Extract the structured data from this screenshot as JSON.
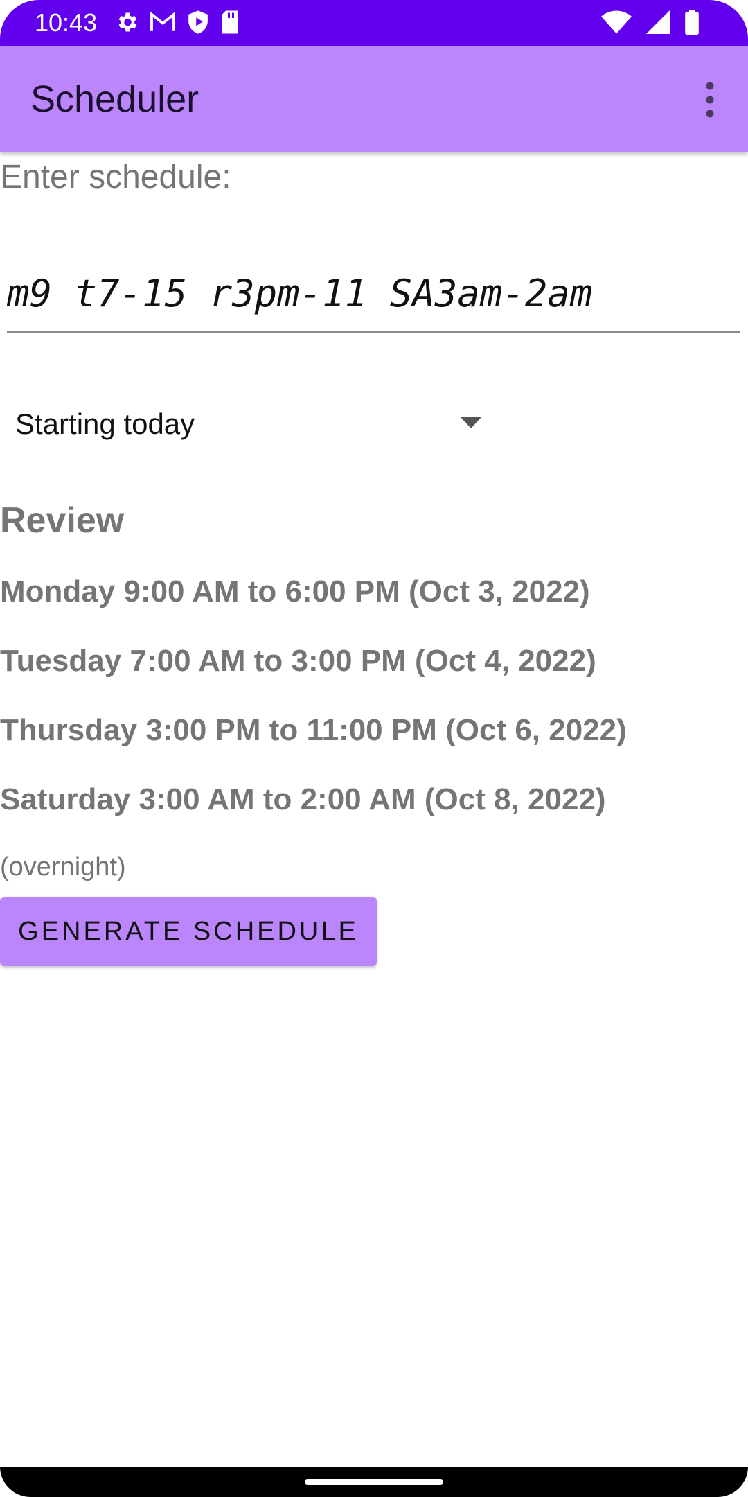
{
  "status_bar": {
    "time": "10:43",
    "left_icons": [
      "gear-icon",
      "gmail-icon",
      "shield-icon",
      "sd-card-icon"
    ],
    "right_icons": [
      "wifi-icon",
      "signal-icon",
      "battery-icon"
    ]
  },
  "app_bar": {
    "title": "Scheduler",
    "menu_icon": "more-vert-icon"
  },
  "form": {
    "prompt": "Enter schedule:",
    "schedule_value": "m9 t7-15 r3pm-11 SA3am-2am",
    "start_option": "Starting today"
  },
  "review": {
    "heading": "Review",
    "lines": [
      "Monday 9:00 AM to 6:00 PM (Oct 3, 2022)",
      "Tuesday 7:00 AM to 3:00 PM (Oct 4, 2022)",
      "Thursday 3:00 PM to 11:00 PM (Oct 6, 2022)",
      "Saturday 3:00 AM to 2:00 AM (Oct 8, 2022)"
    ],
    "note": "(overnight)"
  },
  "actions": {
    "generate_label": "GENERATE SCHEDULE"
  },
  "colors": {
    "status_bar": "#6200ee",
    "app_bar": "#bb86fc",
    "button": "#bb86fc",
    "secondary_text": "#757575"
  }
}
